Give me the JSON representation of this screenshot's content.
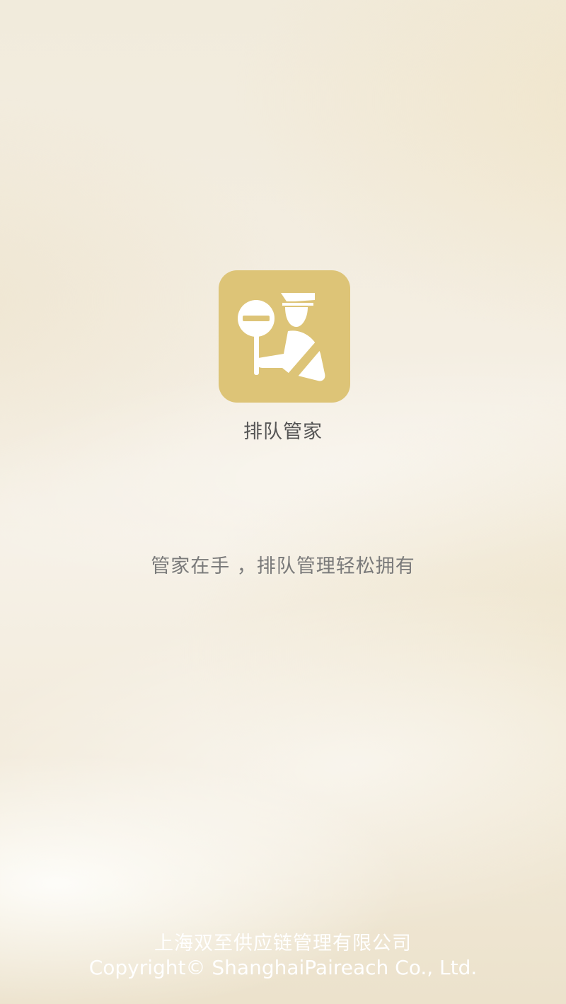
{
  "app": {
    "name": "排队管家",
    "icon": "queue-butler-icon",
    "icon_color": "#ddc477"
  },
  "slogan": "管家在手 ，排队管理轻松拥有",
  "footer": {
    "company": "上海双至供应链管理有限公司",
    "copyright": "Copyright© ShanghaiPaireach Co., Ltd."
  }
}
